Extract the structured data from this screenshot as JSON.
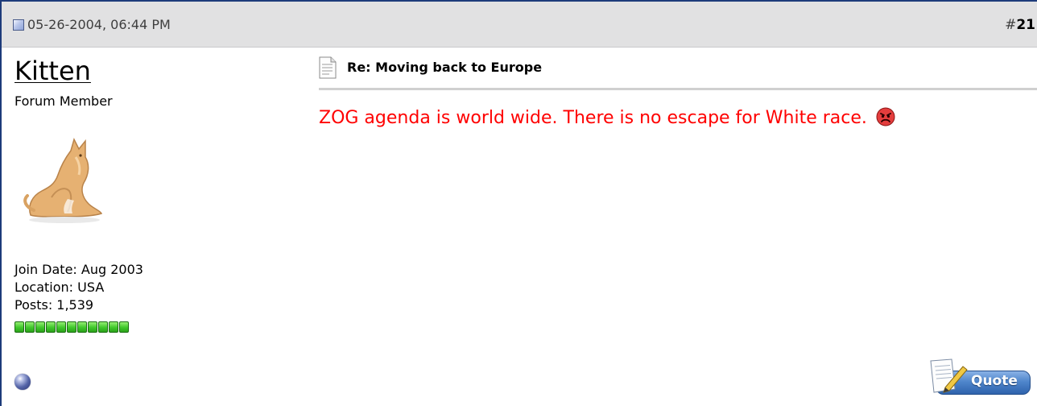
{
  "post": {
    "date": "05-26-2004, 06:44 PM",
    "number_prefix": "#",
    "number": "21"
  },
  "user": {
    "name": "Kitten",
    "title": "Forum Member",
    "join_date": "Join Date: Aug 2003",
    "location": "Location: USA",
    "posts": "Posts: 1,539",
    "reputation_pips": 11,
    "reputation_color": "#3fc72a",
    "status_icon": "offline-status-icon"
  },
  "message": {
    "title": "Re: Moving back to Europe",
    "body": "ZOG agenda is world wide. There is no escape for White race.",
    "body_color": "#ff0000",
    "smiley_icon": "mad-smiley-icon"
  },
  "actions": {
    "quote_label": "Quote"
  },
  "colors": {
    "frame_border": "#1d3b7a",
    "header_bg": "#e1e1e2",
    "divider": "#d0d0d0"
  }
}
